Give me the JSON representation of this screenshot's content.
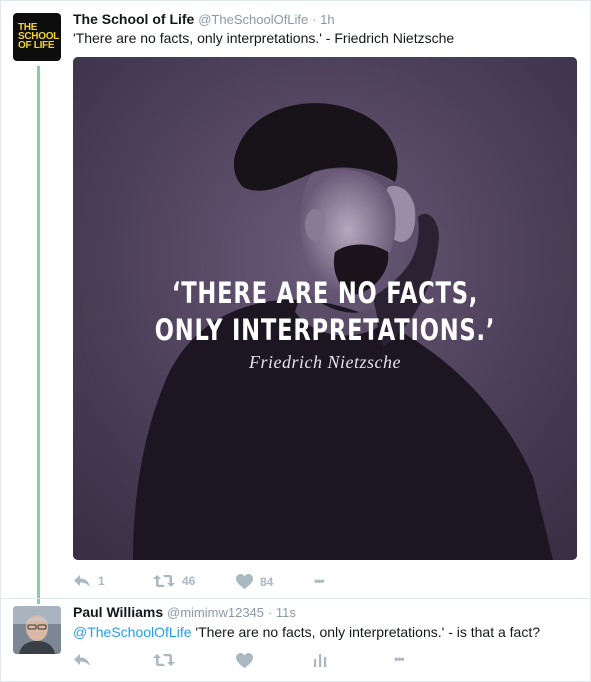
{
  "tweet": {
    "author_name": "The School of Life",
    "handle": "@TheSchoolOfLife",
    "time": "· 1h",
    "text": "'There are no facts, only interpretations.' - Friedrich Nietzsche",
    "avatar_logo": [
      "THE",
      "SCHOOL",
      "OF LIFE"
    ],
    "media": {
      "quote_line1": "‘THERE ARE NO FACTS,",
      "quote_line2": "ONLY INTERPRETATIONS.’",
      "author": "Friedrich Nietzsche"
    },
    "actions": {
      "reply_count": "1",
      "retweet_count": "46",
      "like_count": "84",
      "more": "•••"
    }
  },
  "reply": {
    "author_name": "Paul Williams",
    "handle": "@mimimw12345",
    "time": "· 11s",
    "mention": "@TheSchoolOfLife",
    "text": " 'There are no facts, only interpretations.' - is that a fact?",
    "actions": {
      "more": "•••"
    }
  },
  "colors": {
    "accent_link": "#1da1f2",
    "thread_line": "#7ed3a1",
    "muted": "#8899a6",
    "icon": "#aab8c2",
    "logo_yellow": "#f2d32b"
  },
  "icons": [
    "reply-icon",
    "retweet-icon",
    "like-icon",
    "analytics-icon",
    "more-icon"
  ]
}
